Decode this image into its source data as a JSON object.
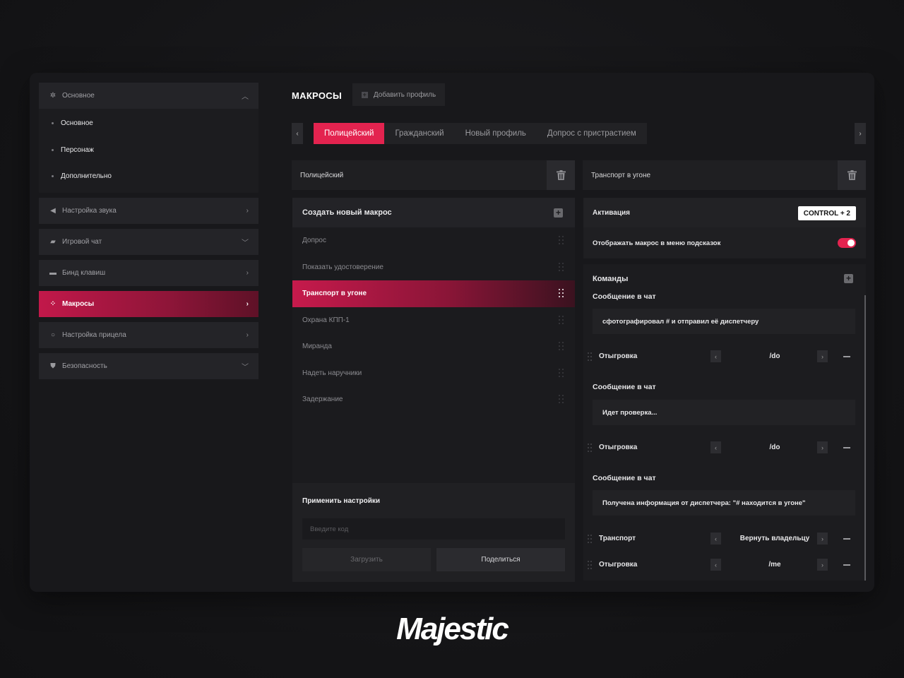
{
  "sidebar": {
    "items": [
      {
        "label": "Основное",
        "icon": "gear-icon",
        "state": "expanded"
      },
      {
        "label": "Настройка звука",
        "icon": "speaker-icon",
        "state": "collapsed"
      },
      {
        "label": "Игровой чат",
        "icon": "chat-icon",
        "state": "dropdown"
      },
      {
        "label": "Бинд клавиш",
        "icon": "keyboard-icon",
        "state": "collapsed"
      },
      {
        "label": "Макросы",
        "icon": "macro-icon",
        "state": "active"
      },
      {
        "label": "Настройка прицела",
        "icon": "crosshair-icon",
        "state": "collapsed"
      },
      {
        "label": "Безопасность",
        "icon": "shield-icon",
        "state": "dropdown"
      }
    ],
    "subitems": [
      "Основное",
      "Персонаж",
      "Дополнительно"
    ]
  },
  "header": {
    "title": "МАКРОСЫ",
    "add_profile": "Добавить профиль"
  },
  "tabs": [
    "Полицейский",
    "Гражданский",
    "Новый профиль",
    "Допрос с пристрастием"
  ],
  "active_tab": "Полицейский",
  "left_column": {
    "profile_name": "Полицейский",
    "create_label": "Создать новый макрос",
    "macros": [
      "Допрос",
      "Показать удостоверение",
      "Транспорт в угоне",
      "Охрана КПП-1",
      "Миранда",
      "Надеть наручники",
      "Задержание"
    ],
    "active_macro": "Транспорт в угоне"
  },
  "apply": {
    "title": "Применить настройки",
    "code_placeholder": "Введите код",
    "load_label": "Загрузить",
    "share_label": "Поделиться"
  },
  "right_column": {
    "macro_name": "Транспорт в угоне",
    "activation_label": "Активация",
    "activation_key": "CONTROL + 2",
    "show_in_hints_label": "Отображать макрос в меню подсказок",
    "show_in_hints": true,
    "commands_label": "Команды",
    "messages": [
      {
        "label": "Сообщение в чат",
        "text": "сфотографировал # и отправил её диспетчеру"
      },
      {
        "label": "Сообщение в чат",
        "text": "Идет проверка..."
      },
      {
        "label": "Сообщение в чат",
        "text": "Получена информация от диспетчера: \"# находится в угоне\""
      }
    ],
    "rows": [
      {
        "label": "Отыгровка",
        "value": "/do"
      },
      {
        "label": "Отыгровка",
        "value": "/do"
      },
      {
        "label": "Транспорт",
        "value": "Вернуть владельцу"
      },
      {
        "label": "Отыгровка",
        "value": "/me"
      }
    ]
  },
  "brand": "Majestic",
  "colors": {
    "accent": "#e3234f",
    "background": "#141416",
    "panel": "#18181b"
  }
}
